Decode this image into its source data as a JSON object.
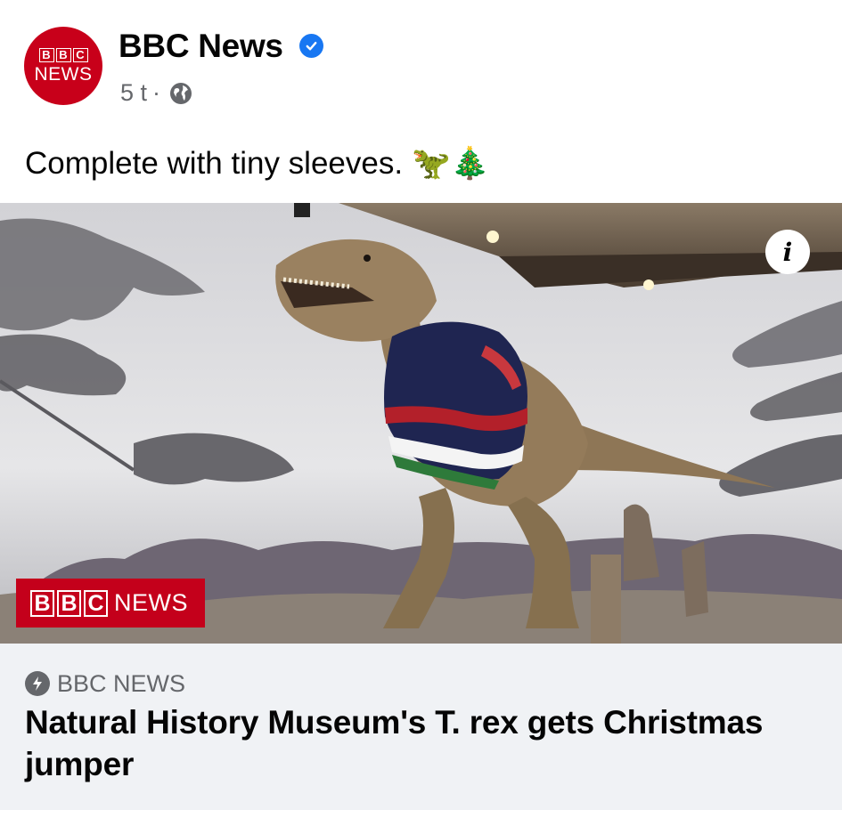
{
  "post": {
    "page_name": "BBC News",
    "time": "5 t",
    "separator": "·",
    "caption": "Complete with tiny sleeves.",
    "caption_emojis": "🦖🎄"
  },
  "avatar": {
    "blocks": [
      "B",
      "B",
      "C"
    ],
    "news": "NEWS"
  },
  "image": {
    "badge_blocks": [
      "B",
      "B",
      "C"
    ],
    "badge_news": "NEWS",
    "info_glyph": "i"
  },
  "link": {
    "source": "BBC NEWS",
    "headline": "Natural History Museum's T. rex gets Christmas jumper"
  },
  "colors": {
    "bbc_red": "#c4001b",
    "verified_blue": "#1877f2",
    "meta_gray": "#65676b",
    "link_bg": "#f0f2f5"
  },
  "icons": [
    "verified-icon",
    "globe-icon",
    "info-icon",
    "news-source-icon"
  ]
}
